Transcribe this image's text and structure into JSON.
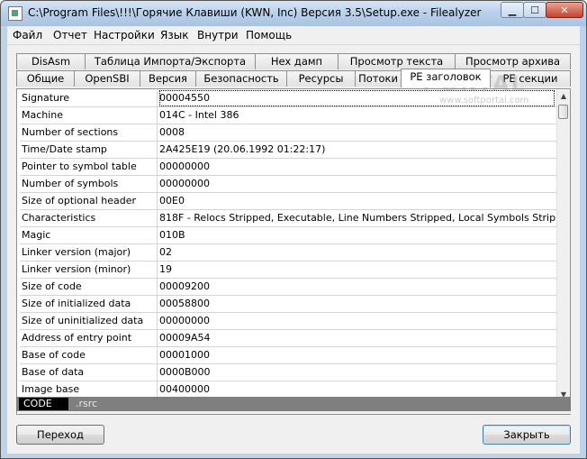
{
  "window": {
    "title": "C:\\Program Files\\!!!\\Горячие Клавиши (KWN, Inc) Версия 3.5\\Setup.exe - Filealyzer",
    "controls": {
      "minimize": "▁",
      "maximize": "☐",
      "close": "✕"
    }
  },
  "menu": [
    "Файл",
    "Отчет",
    "Настройки",
    "Язык",
    "Внутри",
    "Помощь"
  ],
  "tabs_row1": [
    "DisAsm",
    "Таблица Импорта/Экспорта",
    "Hex дамп",
    "Просмотр текста",
    "Просмотр архива"
  ],
  "tabs_row2": [
    "Общие",
    "OpenSBI",
    "Версия",
    "Безопасность",
    "Ресурсы",
    "Потоки",
    "PE заголовок",
    "PE секции"
  ],
  "active_tab": "PE заголовок",
  "rows": [
    {
      "key": "Signature",
      "value": "00004550"
    },
    {
      "key": "Machine",
      "value": "014C - Intel 386"
    },
    {
      "key": "Number of sections",
      "value": "0008"
    },
    {
      "key": "Time/Date stamp",
      "value": "2A425E19 (20.06.1992 01:22:17)"
    },
    {
      "key": "Pointer to symbol table",
      "value": "00000000"
    },
    {
      "key": "Number of symbols",
      "value": "00000000"
    },
    {
      "key": "Size of optional header",
      "value": "00E0"
    },
    {
      "key": "Characteristics",
      "value": "818F - Relocs Stripped, Executable, Line Numbers Stripped, Local Symbols Stripped, Bytes Re"
    },
    {
      "key": "Magic",
      "value": "010B"
    },
    {
      "key": "Linker version (major)",
      "value": "02"
    },
    {
      "key": "Linker version (minor)",
      "value": "19"
    },
    {
      "key": "Size of code",
      "value": "00009200"
    },
    {
      "key": "Size of initialized data",
      "value": "00058800"
    },
    {
      "key": "Size of uninitialized data",
      "value": "00000000"
    },
    {
      "key": "Address of entry point",
      "value": "00009A54"
    },
    {
      "key": "Base of code",
      "value": "00001000"
    },
    {
      "key": "Base of data",
      "value": "0000B000"
    },
    {
      "key": "Image base",
      "value": "00400000"
    }
  ],
  "sections": [
    "CODE",
    ".rsrc"
  ],
  "watermark": {
    "main": "PORTAL",
    "url": "www.softportal.com"
  },
  "buttons": {
    "goto": "Переход",
    "close": "Закрыть"
  },
  "scrollbar": {
    "up": "▲",
    "down": "▼"
  }
}
